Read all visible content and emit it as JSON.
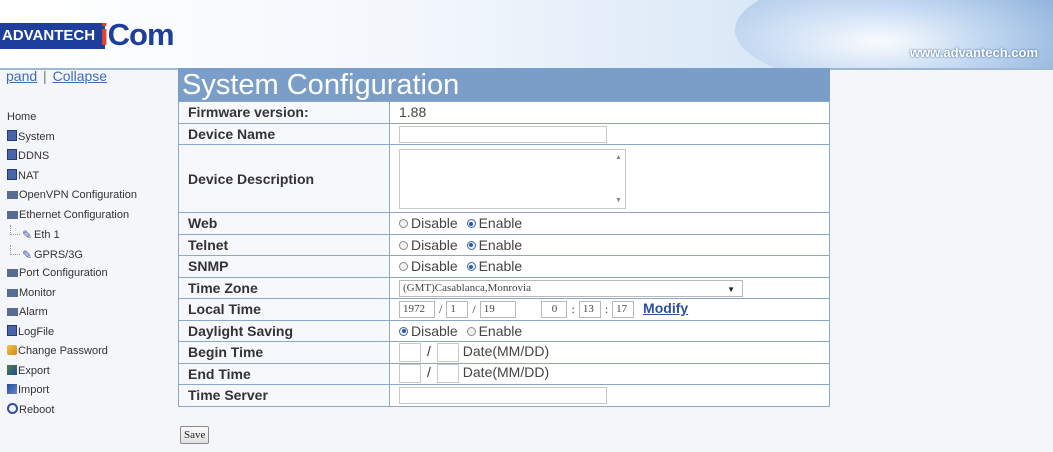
{
  "header": {
    "logo_left": "ADVANTECH",
    "logo_right_i": "i",
    "logo_right_rest": "Com",
    "site_url": "www.advantech.com"
  },
  "nav_links": {
    "expand": "pand",
    "separator": "|",
    "collapse": "Collapse"
  },
  "tree": [
    {
      "label": "Home",
      "icon": "none"
    },
    {
      "label": "System",
      "icon": "page-icon"
    },
    {
      "label": "DDNS",
      "icon": "page-icon"
    },
    {
      "label": "NAT",
      "icon": "page-icon"
    },
    {
      "label": "OpenVPN Configuration",
      "icon": "folder-icon"
    },
    {
      "label": "Ethernet Configuration",
      "icon": "folder-open-icon"
    },
    {
      "label": "Eth 1",
      "icon": "plug-icon"
    },
    {
      "label": "GPRS/3G",
      "icon": "plug-icon"
    },
    {
      "label": "Port Configuration",
      "icon": "folder-icon"
    },
    {
      "label": "Monitor",
      "icon": "folder-icon"
    },
    {
      "label": "Alarm",
      "icon": "folder-icon"
    },
    {
      "label": "LogFile",
      "icon": "page-icon"
    },
    {
      "label": "Change Password",
      "icon": "key-icon"
    },
    {
      "label": "Export",
      "icon": "export-icon"
    },
    {
      "label": "Import",
      "icon": "import-icon"
    },
    {
      "label": "Reboot",
      "icon": "reboot-icon"
    }
  ],
  "page_title": "System Configuration",
  "form": {
    "firmware_label": "Firmware version:",
    "firmware_value": "1.88",
    "device_name_label": "Device Name",
    "device_name_value": "",
    "device_description_label": "Device Description",
    "device_description_value": "",
    "web_label": "Web",
    "telnet_label": "Telnet",
    "snmp_label": "SNMP",
    "disable": "Disable",
    "enable": "Enable",
    "web_selected": "Enable",
    "telnet_selected": "Enable",
    "snmp_selected": "Enable",
    "time_zone_label": "Time Zone",
    "time_zone_value": "(GMT)Casablanca,Monrovia",
    "local_time_label": "Local Time",
    "year": "1972",
    "month": "1",
    "day": "19",
    "hour": "0",
    "minute": "13",
    "second": "17",
    "date_sep": "/",
    "time_sep": ":",
    "modify": "Modify",
    "daylight_label": "Daylight Saving",
    "daylight_selected": "Disable",
    "begin_time_label": "Begin Time",
    "end_time_label": "End Time",
    "date_hint": "Date(MM/DD)",
    "time_server_label": "Time Server",
    "time_server_value": ""
  },
  "save_button": "Save"
}
